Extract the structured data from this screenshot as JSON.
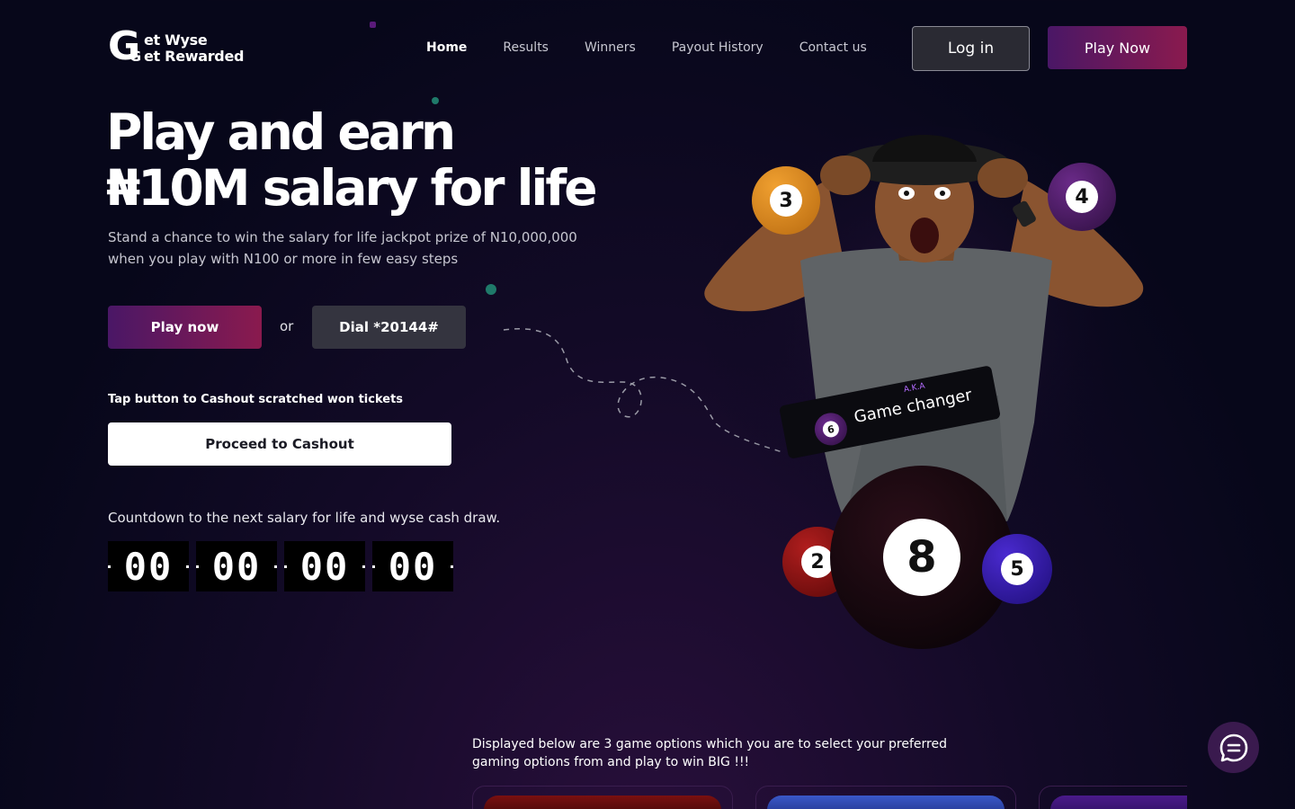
{
  "brand": {
    "g_letter": "G",
    "line1": "et Wyse",
    "line2_g": "G",
    "line2": "et Rewarded"
  },
  "nav": {
    "items": [
      {
        "label": "Home",
        "active": true
      },
      {
        "label": "Results",
        "active": false
      },
      {
        "label": "Winners",
        "active": false
      },
      {
        "label": "Payout History",
        "active": false
      },
      {
        "label": "Contact us",
        "active": false
      }
    ]
  },
  "header": {
    "login_label": "Log in",
    "play_label": "Play Now"
  },
  "hero": {
    "title_line1": "Play and earn",
    "title_line2": "₦10M salary for life",
    "subtitle": "Stand a chance to win the salary for life jackpot prize of N10,000,000 when you play with N100 or more in few easy steps",
    "play_now_label": "Play now",
    "or_text": "or",
    "dial_label": "Dial *20144#",
    "tap_text": "Tap button to Cashout scratched won tickets",
    "cashout_label": "Proceed to Cashout",
    "countdown_text": "Countdown to the next salary for life and wyse cash draw.",
    "countdown": [
      "00",
      "00",
      "00",
      "00"
    ]
  },
  "art": {
    "aka": "A.K.A",
    "tag_label": "Game changer",
    "balls": [
      "3",
      "4",
      "6",
      "2",
      "8",
      "5"
    ]
  },
  "games": {
    "intro": "Displayed below are 3 game options which you are to select your preferred gaming options from and play to win BIG !!!"
  },
  "colors": {
    "accent_start": "#4a1766",
    "accent_end": "#8a1a4e",
    "background": "#07071a"
  }
}
